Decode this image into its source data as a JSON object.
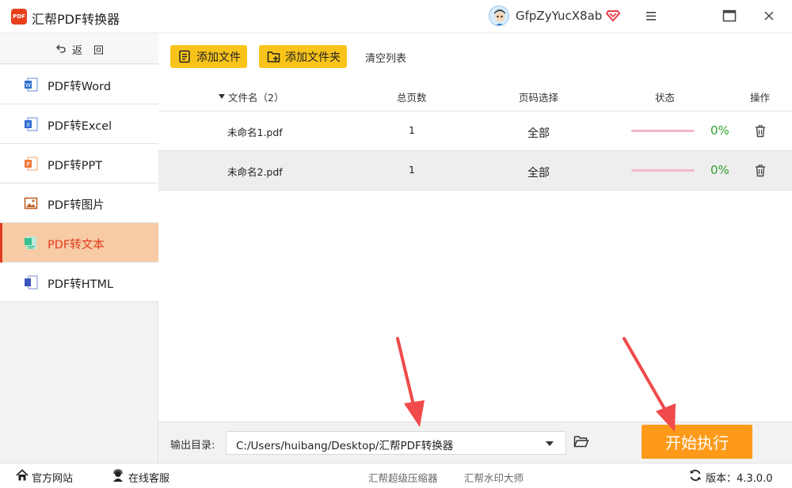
{
  "app": {
    "title": "汇帮PDF转换器",
    "logo_text": "PDF",
    "username": "GfpZyYucX8ab"
  },
  "sidebar": {
    "back_label": "返回",
    "items": [
      {
        "label": "PDF转Word",
        "icon": "word-icon"
      },
      {
        "label": "PDF转Excel",
        "icon": "excel-icon"
      },
      {
        "label": "PDF转PPT",
        "icon": "ppt-icon"
      },
      {
        "label": "PDF转图片",
        "icon": "image-icon"
      },
      {
        "label": "PDF转文本",
        "icon": "text-icon",
        "active": true
      },
      {
        "label": "PDF转HTML",
        "icon": "html-icon"
      }
    ]
  },
  "toolbar": {
    "add_file": "添加文件",
    "add_folder": "添加文件夹",
    "clear_list": "清空列表"
  },
  "table": {
    "headers": {
      "filename": "文件名（2）",
      "pages": "总页数",
      "page_select": "页码选择",
      "status": "状态",
      "actions": "操作"
    },
    "rows": [
      {
        "filename": "未命名1.pdf",
        "pages": "1",
        "page_select": "全部",
        "progress": "0%"
      },
      {
        "filename": "未命名2.pdf",
        "pages": "1",
        "page_select": "全部",
        "progress": "0%"
      }
    ]
  },
  "output": {
    "label": "输出目录:",
    "path": "C:/Users/huibang/Desktop/汇帮PDF转换器",
    "start_button": "开始执行"
  },
  "footer": {
    "website": "官方网站",
    "support": "在线客服",
    "link1": "汇帮超级压缩器",
    "link2": "汇帮水印大师",
    "version": "版本：4.3.0.0"
  },
  "colors": {
    "accent_yellow": "#f9c41a",
    "start_orange": "#fd9a1a",
    "active_bg": "#f7cba5",
    "active_text": "#e03a1e",
    "progress_green": "#2fa12f",
    "arrow_red": "#f04a4a"
  }
}
